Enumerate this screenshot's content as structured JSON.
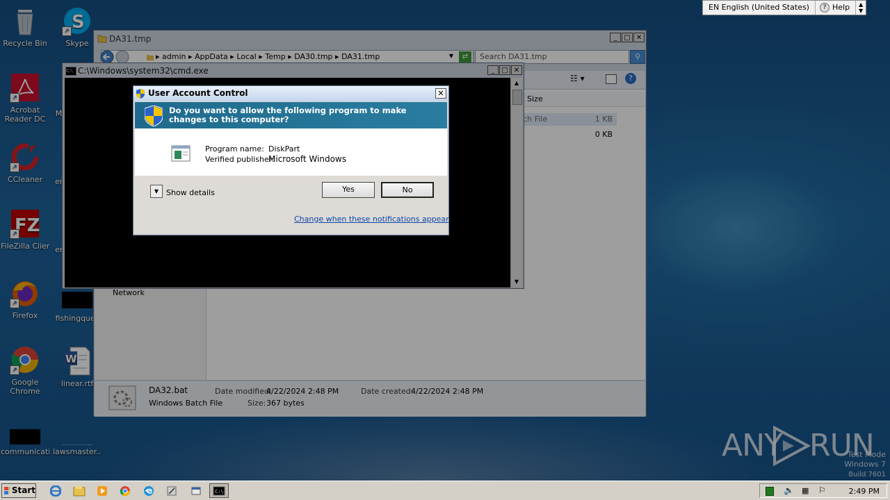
{
  "desktop": {
    "icons": [
      {
        "label": "Recycle Bin",
        "name": "recycle-bin-icon"
      },
      {
        "label": "Skype",
        "name": "skype-icon"
      },
      {
        "label": "Acrobat Reader DC",
        "name": "acrobat-reader-icon"
      },
      {
        "label": "Mi",
        "name": "partial-icon"
      },
      {
        "label": "CCleaner",
        "name": "ccleaner-icon"
      },
      {
        "label": "en",
        "name": "partial-icon"
      },
      {
        "label": "FileZilla Client",
        "name": "filezilla-icon"
      },
      {
        "label": "en",
        "name": "partial-icon"
      },
      {
        "label": "Firefox",
        "name": "firefox-icon"
      },
      {
        "label": "fishingques",
        "name": "file-icon"
      },
      {
        "label": "Google Chrome",
        "name": "chrome-icon"
      },
      {
        "label": "linear.rtf",
        "name": "word-document-icon"
      },
      {
        "label": "communicati...",
        "name": "file-icon"
      },
      {
        "label": "lawsmaster...",
        "name": "file-icon"
      }
    ],
    "watermark": {
      "brand_left": "ANY",
      "brand_right": "RUN",
      "line1": "Test Mode",
      "line2": "Windows 7",
      "line3": "Build 7601"
    }
  },
  "language_bar": {
    "language": "EN English (United States)",
    "help": "Help"
  },
  "explorer": {
    "title": "DA31.tmp",
    "breadcrumbs": [
      "admin",
      "AppData",
      "Local",
      "Temp",
      "DA30.tmp",
      "DA31.tmp"
    ],
    "search_placeholder": "Search DA31.tmp",
    "columns": {
      "size": "Size"
    },
    "rows": [
      {
        "type": "atch File",
        "size": "1 KB"
      },
      {
        "size": "0 KB"
      }
    ],
    "nav_item": "Network",
    "status": {
      "file_name": "DA32.bat",
      "file_type": "Windows Batch File",
      "date_modified_label": "Date modified:",
      "date_modified": "4/22/2024 2:48 PM",
      "date_created_label": "Date created:",
      "date_created": "4/22/2024 2:48 PM",
      "size_label": "Size:",
      "size": "367 bytes"
    }
  },
  "cmd": {
    "title": "C:\\Windows\\system32\\cmd.exe"
  },
  "uac": {
    "title": "User Account Control",
    "question": "Do you want to allow the following program to make changes to this computer?",
    "program_name_label": "Program name:",
    "program_name": "DiskPart",
    "publisher_label": "Verified publisher:",
    "publisher": "Microsoft Windows",
    "show_details": "Show details",
    "yes": "Yes",
    "no": "No",
    "change_link": "Change when these notifications appear",
    "colors": {
      "banner": "#1f6a8c",
      "link": "#0a46a8"
    }
  },
  "taskbar": {
    "start_label": "Start",
    "clock": "2:49 PM",
    "items": [
      "ie-icon",
      "explorer-icon",
      "media-player-icon",
      "chrome-icon",
      "edge-icon",
      "tool-icon",
      "window-icon",
      "cmd-icon"
    ]
  }
}
